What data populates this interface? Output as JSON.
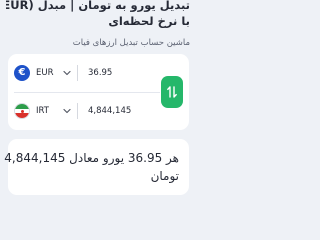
{
  "header": {
    "title_line1": "تبدیل یورو به تومان | مبدل (EUR) به (IRT)",
    "title_line2": "با نرخ لحظه‌ای",
    "subtitle": "ماشین حساب تبدیل ارزهای فیات"
  },
  "converter": {
    "from": {
      "flag_icon": "eu-flag-icon",
      "currency": "EUR",
      "amount": "36.95"
    },
    "to": {
      "flag_icon": "iran-flag-icon",
      "currency": "IRT",
      "amount": "4,844,145"
    },
    "swap_icon": "swap-vertical-icon",
    "accent_color": "#25b76a"
  },
  "result": {
    "line1": "هر 36.95 یورو معادل 4,844,145",
    "line2": "تومان"
  }
}
